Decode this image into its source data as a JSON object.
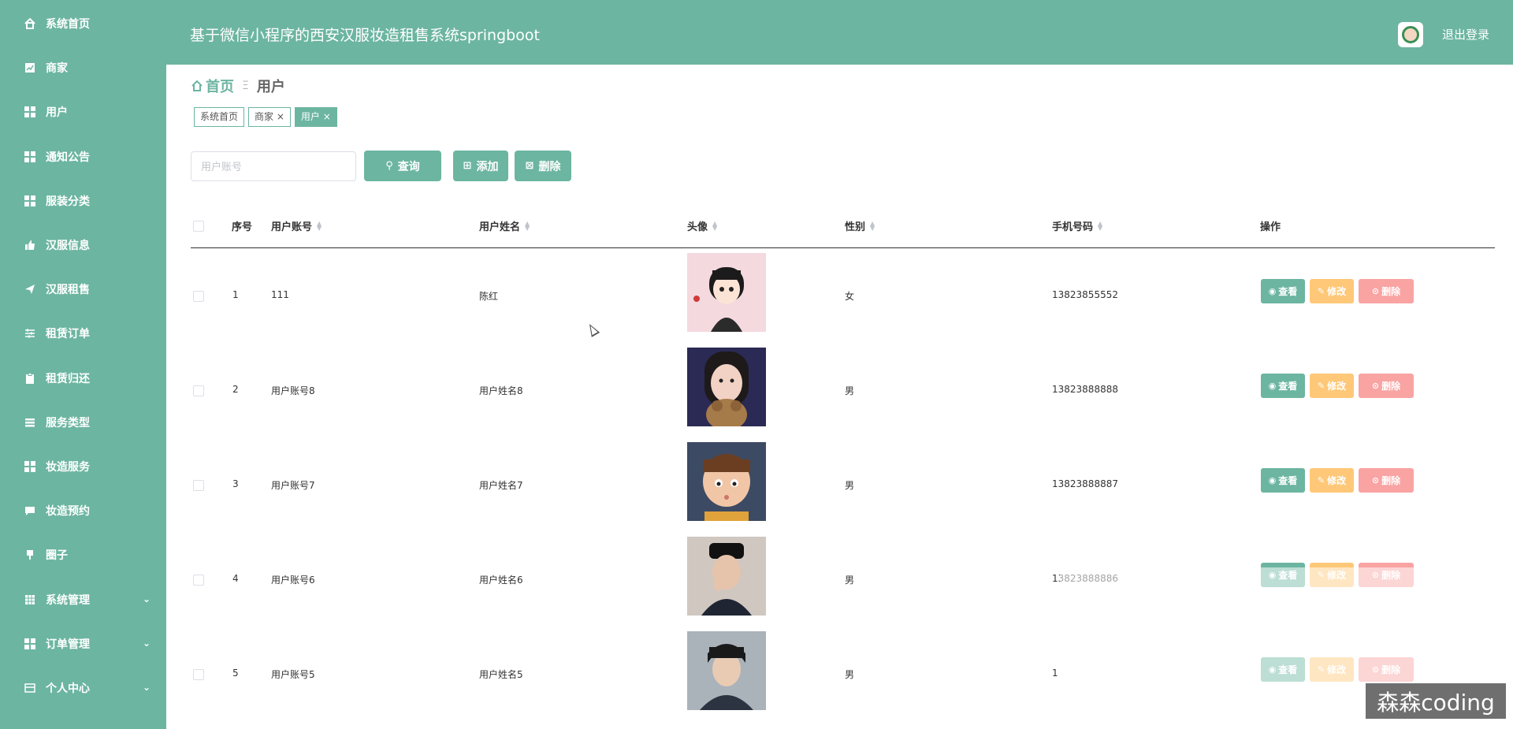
{
  "app_title": "基于微信小程序的西安汉服妆造租售系统springboot",
  "header": {
    "logout_label": "退出登录"
  },
  "sidebar": {
    "items": [
      {
        "label": "系统首页",
        "icon": "home-icon"
      },
      {
        "label": "商家",
        "icon": "chart-icon"
      },
      {
        "label": "用户",
        "icon": "grid-icon"
      },
      {
        "label": "通知公告",
        "icon": "grid-icon"
      },
      {
        "label": "服装分类",
        "icon": "grid-icon"
      },
      {
        "label": "汉服信息",
        "icon": "thumb-icon"
      },
      {
        "label": "汉服租售",
        "icon": "send-icon"
      },
      {
        "label": "租赁订单",
        "icon": "sliders-icon"
      },
      {
        "label": "租赁归还",
        "icon": "clipboard-icon"
      },
      {
        "label": "服务类型",
        "icon": "list-icon"
      },
      {
        "label": "妆造服务",
        "icon": "grid-icon"
      },
      {
        "label": "妆造预约",
        "icon": "comment-icon"
      },
      {
        "label": "圈子",
        "icon": "pin-icon"
      },
      {
        "label": "系统管理",
        "icon": "table-icon",
        "expandable": true
      },
      {
        "label": "订单管理",
        "icon": "grid-icon",
        "expandable": true
      },
      {
        "label": "个人中心",
        "icon": "card-icon",
        "expandable": true
      }
    ]
  },
  "breadcrumb": {
    "home": "首页",
    "separator": "Ξ",
    "current": "用户"
  },
  "tags": [
    {
      "label": "系统首页",
      "closable": false,
      "active": false
    },
    {
      "label": "商家",
      "closable": true,
      "active": false
    },
    {
      "label": "用户",
      "closable": true,
      "active": true
    }
  ],
  "search": {
    "placeholder": "用户账号",
    "value": "",
    "query_label": "查询",
    "add_label": "添加",
    "delete_label": "删除"
  },
  "table": {
    "columns": [
      "序号",
      "用户账号",
      "用户姓名",
      "头像",
      "性别",
      "手机号码",
      "操作"
    ],
    "rows": [
      {
        "index": "1",
        "account": "111",
        "name": "陈红",
        "gender": "女",
        "phone": "13823855552"
      },
      {
        "index": "2",
        "account": "用户账号8",
        "name": "用户姓名8",
        "gender": "男",
        "phone": "13823888888"
      },
      {
        "index": "3",
        "account": "用户账号7",
        "name": "用户姓名7",
        "gender": "男",
        "phone": "13823888887"
      },
      {
        "index": "4",
        "account": "用户账号6",
        "name": "用户姓名6",
        "gender": "男",
        "phone": "13823888886"
      },
      {
        "index": "5",
        "account": "用户账号5",
        "name": "用户姓名5",
        "gender": "男",
        "phone": "1"
      }
    ],
    "actions": {
      "view": "查看",
      "edit": "修改",
      "delete": "删除"
    }
  },
  "watermark": "森森coding",
  "colors": {
    "primary": "#6cb5a1",
    "edit": "#ffc878",
    "delete": "#f9a3a3"
  }
}
